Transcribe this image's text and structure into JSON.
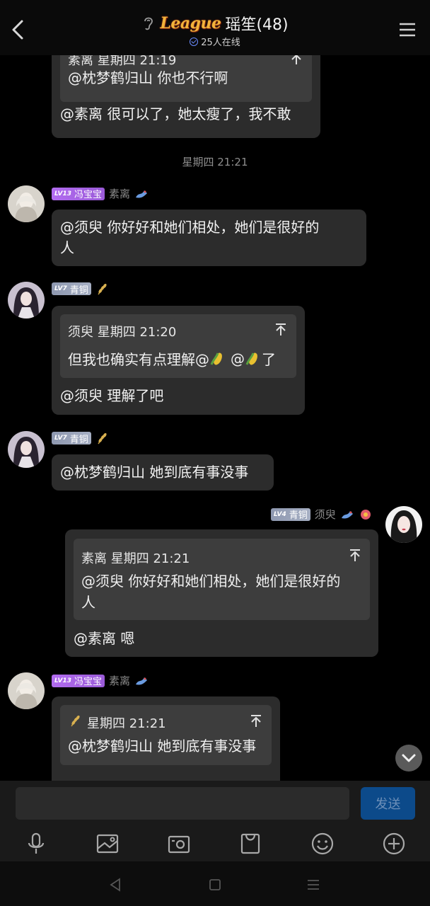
{
  "header": {
    "badge": "League",
    "title": "瑶笙(48)",
    "online": "25人在线"
  },
  "messages": {
    "m1": {
      "quote_head": "素离 星期四 21:19",
      "quote_body": "@枕梦鹤归山 你也不行啊",
      "text": "@素离 很可以了，她太瘦了，我不敢"
    },
    "timestamp": "星期四 21:21",
    "m2": {
      "level": "LV13",
      "badge": "冯宝宝",
      "nick": "素离",
      "text_line1": "@须臾 你好好和她们相处，她们是很好的",
      "text_line2": "人"
    },
    "m3": {
      "level": "LV7",
      "badge": "青铜",
      "quote_head": "须臾 星期四 21:20",
      "quote_body_a": "但我也确实有点理解@",
      "quote_body_b": "@",
      "quote_body_c": "了",
      "text": "@须臾 理解了吧"
    },
    "m4": {
      "level": "LV7",
      "badge": "青铜",
      "text": "@枕梦鹤归山 她到底有事没事"
    },
    "m5": {
      "level": "LV4",
      "badge": "青铜",
      "nick": "须臾",
      "quote_head": "素离 星期四 21:21",
      "quote_line1": "@须臾 你好好和她们相处，她们是很好的",
      "quote_line2": "人",
      "text": "@素离 嗯"
    },
    "m6": {
      "level": "LV13",
      "badge": "冯宝宝",
      "nick": "素离",
      "quote_head": "星期四 21:21",
      "quote_body": "@枕梦鹤归山 她到底有事没事"
    }
  },
  "input": {
    "placeholder": "",
    "send_label": "发送"
  },
  "toolbar": [
    "microphone-icon",
    "image-icon",
    "camera-icon",
    "bag-icon",
    "emoji-icon",
    "plus-icon"
  ],
  "navbar": [
    "nav-back-icon",
    "nav-home-icon",
    "nav-menu-icon"
  ],
  "colors": {
    "background": "#000000",
    "bubble": "#2c2c2c",
    "quote": "#3d3d3d",
    "send_button": "#0c4a8a",
    "level_purple": "#b26cf0",
    "level_gray": "#9aa3b8"
  }
}
